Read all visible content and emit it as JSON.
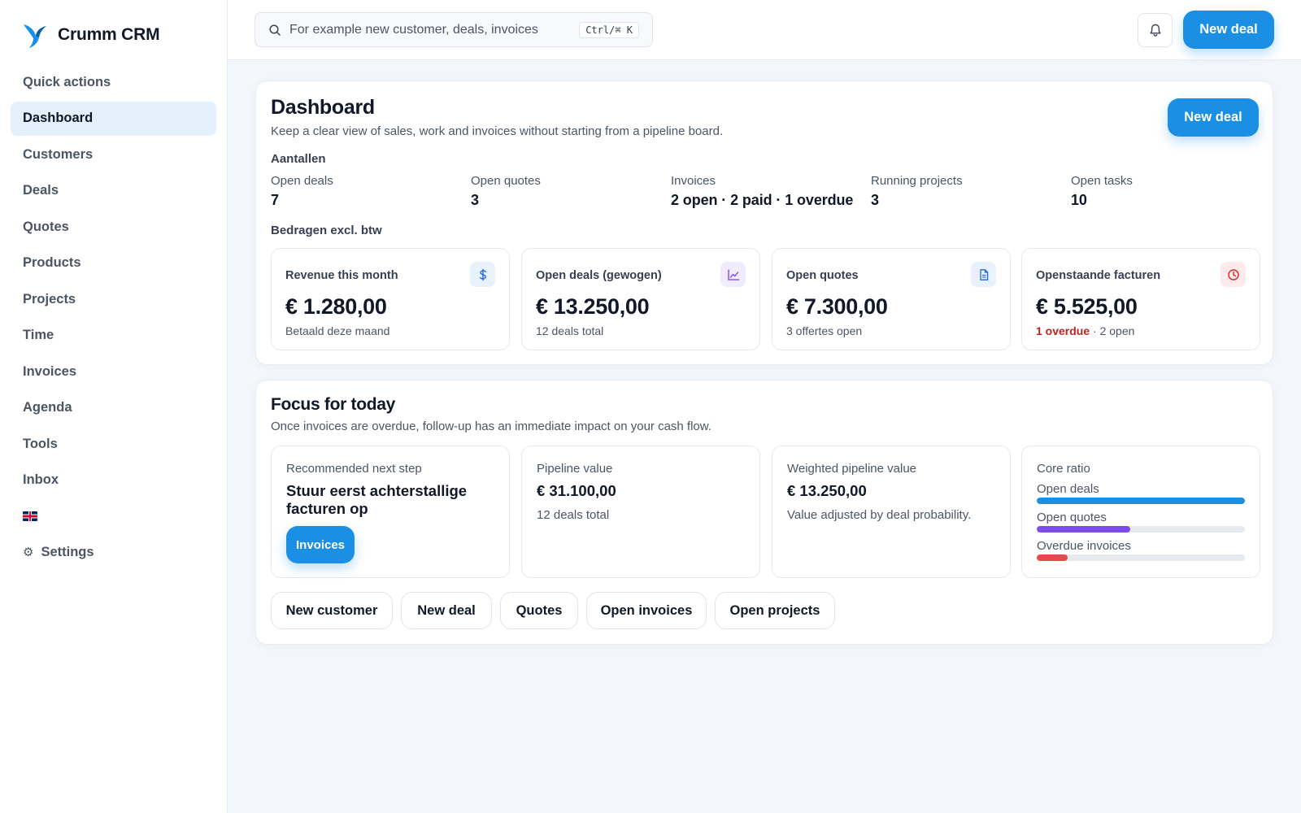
{
  "app": {
    "name": "Crumm CRM"
  },
  "sidebar": {
    "items": [
      {
        "label": "Quick actions"
      },
      {
        "label": "Dashboard",
        "active": true
      },
      {
        "label": "Customers"
      },
      {
        "label": "Deals"
      },
      {
        "label": "Quotes"
      },
      {
        "label": "Products"
      },
      {
        "label": "Projects"
      },
      {
        "label": "Time"
      },
      {
        "label": "Invoices"
      },
      {
        "label": "Agenda"
      },
      {
        "label": "Tools"
      },
      {
        "label": "Inbox"
      }
    ],
    "language_icon": "uk-flag-icon",
    "settings_label": "Settings"
  },
  "topbar": {
    "search_placeholder": "For example new customer, deals, invoices",
    "search_shortcut": "Ctrl/⌘ K",
    "new_deal_label": "New deal"
  },
  "dashboard": {
    "title": "Dashboard",
    "subtitle": "Keep a clear view of sales, work and invoices without starting from a pipeline board.",
    "new_deal_label": "New deal",
    "counts_label": "Aantallen",
    "counts": [
      {
        "label": "Open deals",
        "value": "7"
      },
      {
        "label": "Open quotes",
        "value": "3"
      },
      {
        "label": "Invoices",
        "value": "2 open · 2 paid · 1 overdue"
      },
      {
        "label": "Running projects",
        "value": "3"
      },
      {
        "label": "Open tasks",
        "value": "10"
      }
    ],
    "amounts_label": "Bedragen excl. btw",
    "kpis": [
      {
        "label": "Revenue this month",
        "value": "€ 1.280,00",
        "sub": "Betaald deze maand",
        "icon": "dollar-icon",
        "color": "#2563eb",
        "bg": "#e8f2fd"
      },
      {
        "label": "Open deals (gewogen)",
        "value": "€ 13.250,00",
        "sub": "12 deals total",
        "icon": "line-chart-icon",
        "color": "#7c3aed",
        "bg": "#f0ebfd"
      },
      {
        "label": "Open quotes",
        "value": "€ 7.300,00",
        "sub": "3 offertes open",
        "icon": "document-icon",
        "color": "#2563eb",
        "bg": "#e8f2fd"
      },
      {
        "label": "Openstaande facturen",
        "value": "€ 5.525,00",
        "sub_alert": "1 overdue",
        "sub_rest": " · 2 open",
        "icon": "clock-icon",
        "color": "#dc2626",
        "bg": "#fdeaea"
      }
    ]
  },
  "focus": {
    "title": "Focus for today",
    "subtitle": "Once invoices are overdue, follow-up has an immediate impact on your cash flow.",
    "next_step": {
      "label": "Recommended next step",
      "text": "Stuur eerst achterstallige facturen op",
      "button": "Invoices"
    },
    "pipeline": {
      "label": "Pipeline value",
      "value": "€ 31.100,00",
      "sub": "12 deals total"
    },
    "weighted": {
      "label": "Weighted pipeline value",
      "value": "€ 13.250,00",
      "sub": "Value adjusted by deal probability."
    },
    "core_ratio": {
      "label": "Core ratio",
      "rows": [
        {
          "label": "Open deals",
          "fraction": 1.0,
          "color": "#1a8fe3"
        },
        {
          "label": "Open quotes",
          "fraction": 0.45,
          "color": "#7c4dea"
        },
        {
          "label": "Overdue invoices",
          "fraction": 0.15,
          "color": "#e5484d"
        }
      ]
    },
    "quick_actions": [
      "New customer",
      "New deal",
      "Quotes",
      "Open invoices",
      "Open projects"
    ]
  }
}
